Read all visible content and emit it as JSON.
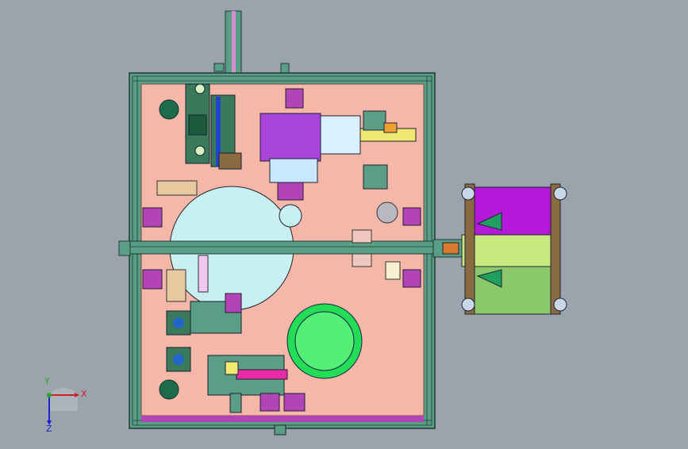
{
  "viewport": {
    "background": "#9ba4ad",
    "frame_color": "#3a6b5c",
    "plate_color": "#f5b8a8"
  },
  "triad": {
    "x_label": "X",
    "y_label": "Y",
    "z_label": "Z",
    "x_color": "#cc2222",
    "y_color": "#22aa22",
    "z_color": "#2222cc"
  }
}
